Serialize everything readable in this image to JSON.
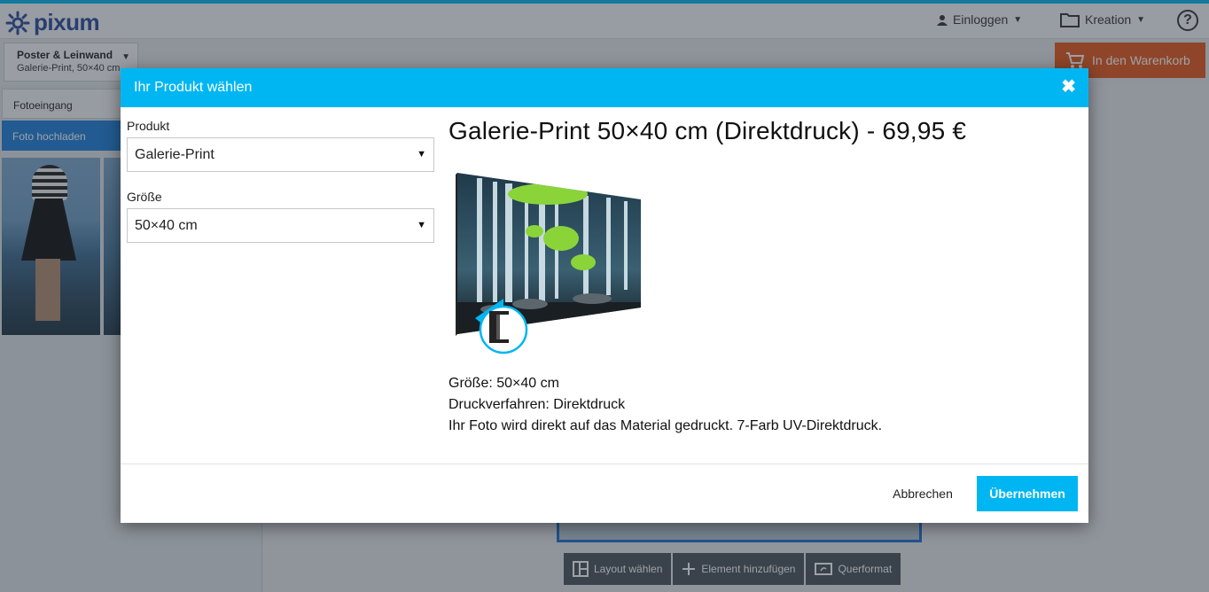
{
  "header": {
    "logo": "pixum",
    "login": "Einloggen",
    "kreation": "Kreation",
    "help": "?"
  },
  "subbar": {
    "category": "Poster & Leinwand",
    "product": "Galerie-Print, 50×40 cm",
    "cart": "In den Warenkorb"
  },
  "sidebar": {
    "tab_inbox": "Fotoeingang",
    "tab_upload": "Foto hochladen"
  },
  "toolbar": {
    "layout": "Layout wählen",
    "add_element": "Element hinzufügen",
    "orientation": "Querformat"
  },
  "modal": {
    "title": "Ihr Produkt wählen",
    "product_label": "Produkt",
    "product_value": "Galerie-Print",
    "size_label": "Größe",
    "size_value": "50×40 cm",
    "product_title": "Galerie-Print 50×40 cm (Direktdruck) - 69,95 €",
    "info_size": "Größe: 50×40 cm",
    "info_print": "Druckverfahren: Direktdruck",
    "info_desc": "Ihr Foto wird direkt auf das Material gedruckt. 7-Farb UV-Direktdruck.",
    "cancel": "Abbrechen",
    "apply": "Übernehmen"
  },
  "colors": {
    "accent": "#00b6f2",
    "cart": "#e4571b",
    "upload_tab": "#1e7fd8"
  }
}
